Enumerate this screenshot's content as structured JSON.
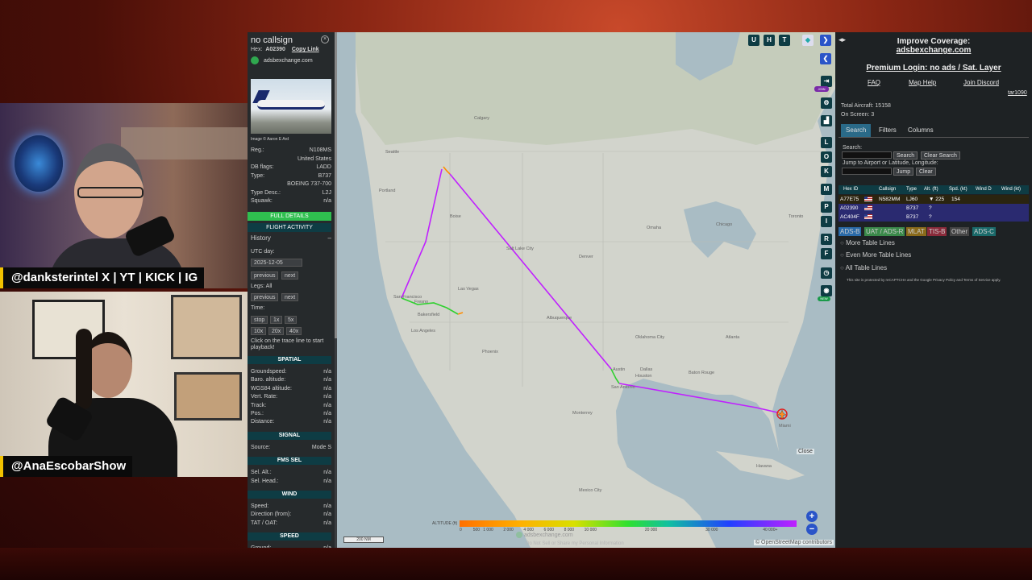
{
  "overlay": {
    "caption_top": "@danksterintel X | YT | KICK | IG",
    "caption_bottom": "@AnaEscobarShow"
  },
  "aircraft": {
    "callsign": "no callsign",
    "hex_label": "Hex:",
    "hex": "A02390",
    "copy_link": "Copy Link",
    "source_link": "adsbexchange.com",
    "photo_credit": "Image © Aaron E Ard",
    "fields": [
      {
        "k": "Reg.:",
        "v": "N108MS"
      },
      {
        "k": "",
        "v": "United States"
      },
      {
        "k": "DB flags:",
        "v": "LADD"
      },
      {
        "k": "Type:",
        "v": "B737"
      },
      {
        "k": "",
        "v": "BOEING 737-700"
      },
      {
        "k": "Type Desc.:",
        "v": "L2J"
      },
      {
        "k": "Squawk:",
        "v": "n/a"
      }
    ],
    "full_details": "FULL DETAILS",
    "flight_activity": "FLIGHT ACTIVITY"
  },
  "history": {
    "title": "History",
    "utc_day_label": "UTC day:",
    "date": "2025-12-05",
    "previous": "previous",
    "next": "next",
    "legs_label": "Legs: All",
    "time_label": "Time:",
    "speed_buttons": [
      "stop",
      "1x",
      "5x",
      "10x",
      "20x",
      "40x"
    ],
    "hint": "Click on the trace line to start playback!"
  },
  "sections": {
    "spatial": {
      "title": "SPATIAL",
      "rows": [
        {
          "k": "Groundspeed:",
          "v": "n/a"
        },
        {
          "k": "Baro. altitude:",
          "v": "n/a"
        },
        {
          "k": "WGS84 altitude:",
          "v": "n/a"
        },
        {
          "k": "Vert. Rate:",
          "v": "n/a"
        },
        {
          "k": "Track:",
          "v": "n/a"
        },
        {
          "k": "Pos.:",
          "v": "n/a"
        },
        {
          "k": "Distance:",
          "v": "n/a"
        }
      ]
    },
    "signal": {
      "title": "SIGNAL",
      "rows": [
        {
          "k": "Source:",
          "v": "Mode S"
        }
      ]
    },
    "fms": {
      "title": "FMS SEL",
      "rows": [
        {
          "k": "Sel. Alt.:",
          "v": "n/a"
        },
        {
          "k": "Sel. Head.:",
          "v": "n/a"
        }
      ]
    },
    "wind": {
      "title": "WIND",
      "rows": [
        {
          "k": "Speed:",
          "v": "n/a"
        },
        {
          "k": "Direction (from):",
          "v": "n/a"
        },
        {
          "k": "TAT / OAT:",
          "v": "n/a"
        }
      ]
    },
    "speed": {
      "title": "SPEED",
      "rows": [
        {
          "k": "Ground:",
          "v": "n/a"
        }
      ]
    }
  },
  "map": {
    "top_buttons": [
      "U",
      "H",
      "T"
    ],
    "side_buttons": [
      "L",
      "O",
      "K",
      "M",
      "P",
      "I",
      "R",
      "F"
    ],
    "altitude_label": "ALTITUDE (ft)",
    "altitude_ticks": [
      "0",
      "500",
      "1 000",
      "2 000",
      "4 000",
      "6 000",
      "8 000",
      "10 000",
      "20 000",
      "30 000",
      "40 000+"
    ],
    "watermark": "adsbexchange.com",
    "watermark_sub": "Do Not Sell or Share my Personal Information",
    "scale": "200 NM",
    "attribution": "© OpenStreetMap contributors",
    "close": "Close",
    "cities": [
      "Calgary",
      "Seattle",
      "Portland",
      "Boise",
      "Salt Lake City",
      "San Francisco",
      "Las Vegas",
      "Fresno",
      "Bakersfield",
      "Los Angeles",
      "Phoenix",
      "Albuquerque",
      "Denver",
      "Omaha",
      "Chicago",
      "Toronto",
      "Oklahoma City",
      "Dallas",
      "Austin",
      "San Antonio",
      "Houston",
      "Baton Rouge",
      "Atlanta",
      "Mexico City",
      "Monterrey",
      "Havana",
      "Miami"
    ],
    "colors": {
      "track_low": "#ff8c00",
      "track_mid": "#30d030",
      "track_high": "#c020ff",
      "land": "#d3d5cf",
      "water": "#a9bcc4"
    }
  },
  "right_panel": {
    "improve": "Improve Coverage:",
    "improve_link": "adsbexchange.com",
    "premium": "Premium Login: no ads / Sat. Layer",
    "faq": "FAQ",
    "map_help": "Map Help",
    "discord": "Join Discord",
    "user": "tar1090",
    "total_aircraft": "Total Aircraft: 15158",
    "on_screen": "On Screen: 3",
    "tabs": [
      "Search",
      "Filters",
      "Columns"
    ],
    "search_label": "Search:",
    "search_btn": "Search",
    "clear_search_btn": "Clear Search",
    "jump_label": "Jump to Airport or Latitude, Longitude:",
    "jump_btn": "Jump",
    "clear_btn": "Clear",
    "columns": [
      "Hex ID",
      "Callsign",
      "Type",
      "Alt. (ft)",
      "Spd. (kt)",
      "Wind D",
      "Wind (kt)"
    ],
    "rows": [
      {
        "hex": "A77E75",
        "callsign": "N582MM",
        "type": "LJ60",
        "alt": "▼ 225",
        "spd": "154"
      },
      {
        "hex": "A02390",
        "callsign": "",
        "type": "B737",
        "alt": "?",
        "spd": ""
      },
      {
        "hex": "AC404F",
        "callsign": "",
        "type": "B737",
        "alt": "?",
        "spd": ""
      }
    ],
    "sources": [
      "ADS-B",
      "UAT / ADS-R",
      "MLAT",
      "TIS-B",
      "Other",
      "ADS-C"
    ],
    "more_rows": "More Table Lines",
    "even_more_rows": "Even More Table Lines",
    "all_rows": "All Table Lines",
    "recaptcha": "This site is protected by reCAPTCHA and the Google Privacy Policy and Terms of Service apply."
  }
}
